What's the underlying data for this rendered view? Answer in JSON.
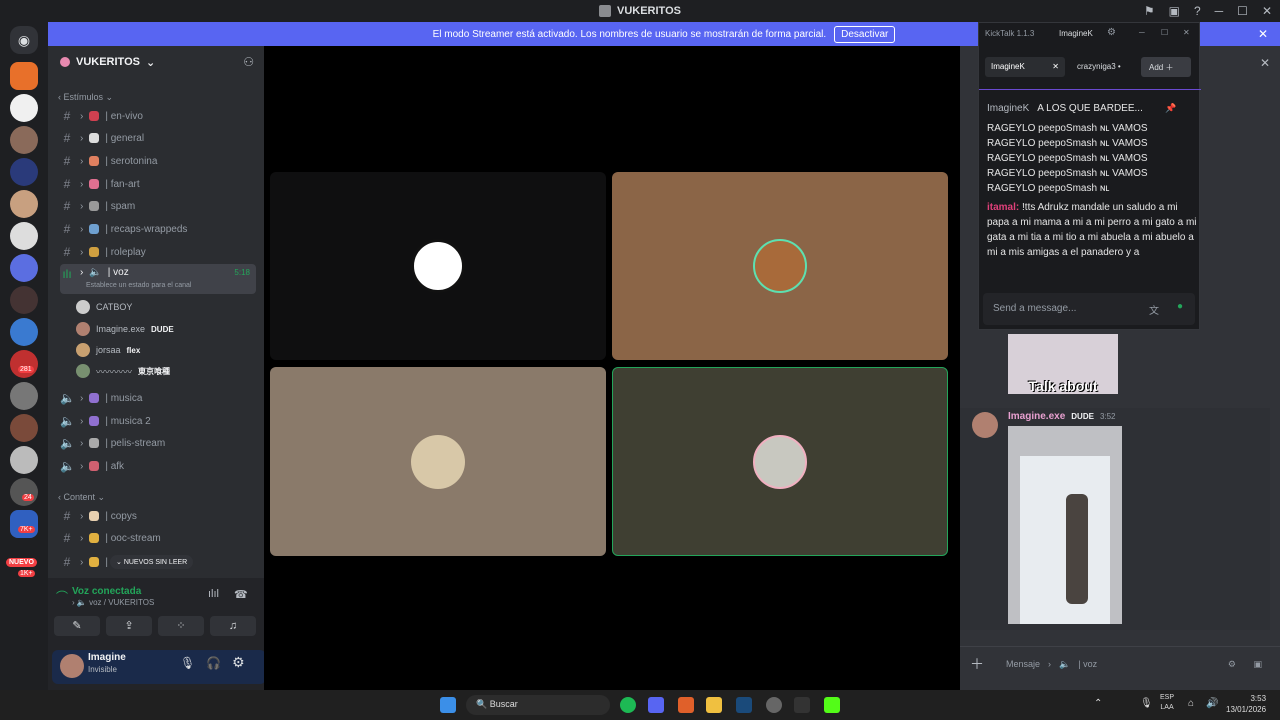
{
  "titlebar": {
    "title": "VUKERITOS"
  },
  "banner": {
    "text": "El modo Streamer está activado. Los nombres de usuario se mostrarán de forma parcial.",
    "button": "Desactivar"
  },
  "guild": {
    "name": "VUKERITOS"
  },
  "categories": {
    "estimulos": "Estímulos",
    "content": "Content"
  },
  "channels": [
    {
      "label": "| en-vivo"
    },
    {
      "label": "| general"
    },
    {
      "label": "| serotonina"
    },
    {
      "label": "| fan-art"
    },
    {
      "label": "| spam"
    },
    {
      "label": "| recaps-wrappeds"
    },
    {
      "label": "| roleplay"
    },
    {
      "label": "| voz"
    },
    {
      "label": "| musica"
    },
    {
      "label": "| musica 2"
    },
    {
      "label": "| pelis-stream"
    },
    {
      "label": "| afk"
    },
    {
      "label": "| copys"
    },
    {
      "label": "| ooc-stream"
    },
    {
      "label": "|"
    }
  ],
  "voice_timer": "5:18",
  "voice_status_hint": "Establece un estado para el canal",
  "voice_users": [
    {
      "name": "CATBOY",
      "tag": ""
    },
    {
      "name": "Imagine.exe",
      "tag": "DUDE"
    },
    {
      "name": "jorsaa",
      "tag": "flex"
    },
    {
      "name": "〰〰〰〰",
      "tag": "東京喰種"
    }
  ],
  "unread_pill": "NUEVOS SIN LEER",
  "voice_panel": {
    "status": "Voz conectada",
    "location": "voz / VUKERITOS"
  },
  "user_panel": {
    "name": "Imagine",
    "status": "Invisible"
  },
  "server_badges": {
    "b1": "281",
    "b2": "24",
    "b3": "7K+",
    "b4": "NUEVO",
    "b5": "1K+"
  },
  "kicktalk": {
    "title": "KickTalk 1.1.3",
    "user": "ImagineK",
    "tabs": [
      "ImagineK",
      "crazyniga3"
    ],
    "add": "Add",
    "pinned_user": "ImagineK",
    "pinned_text": "A LOS QUE BARDEE...",
    "messages": [
      "RAGEYLO peepoSmash ɴʟ VAMOS",
      "RAGEYLO peepoSmash ɴʟ VAMOS",
      "RAGEYLO peepoSmash ɴʟ VAMOS",
      "RAGEYLO peepoSmash ɴʟ VAMOS",
      "RAGEYLO peepoSmash ɴʟ"
    ],
    "tts_user": "itamal:",
    "tts_text": "!tts Adrukz mandale un saludo a mi papa a mi mama a mi a mi perro a mi gato a mi gata a mi tia a mi tio a mi abuela a mi abuelo a mi",
    "tts_tail1": "a mis",
    "tts_tail2": "amigas a el panadero y a",
    "input_placeholder": "Send a message..."
  },
  "chat": {
    "msg_user": "Imagine.exe",
    "msg_tag": "DUDE",
    "msg_time": "3:52",
    "meme_text": "Talk about",
    "input_placeholder": "Mensaje",
    "input_channel": "| voz"
  },
  "taskbar": {
    "search": "Buscar",
    "lang1": "ESP",
    "lang2": "LAA",
    "time": "3:53",
    "date": "13/01/2026"
  }
}
